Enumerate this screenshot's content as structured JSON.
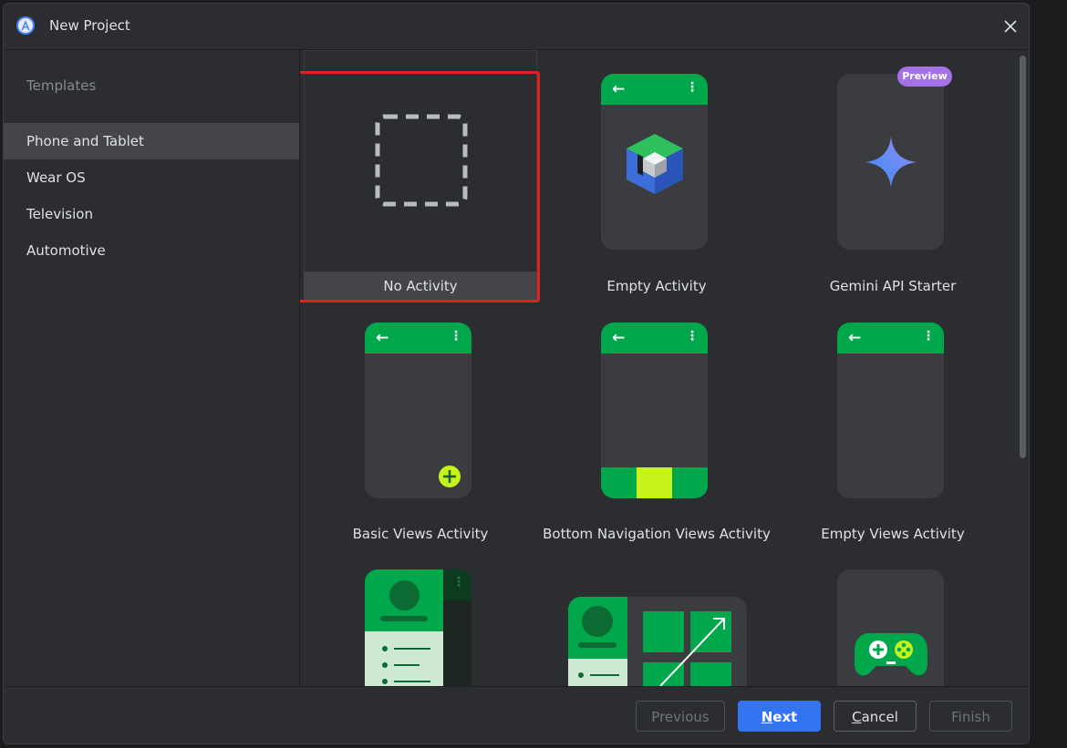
{
  "window": {
    "title": "New Project",
    "app_icon": "android-studio-icon",
    "close_icon": "close-icon"
  },
  "sidebar": {
    "header": "Templates",
    "items": [
      {
        "label": "Phone and Tablet",
        "selected": true
      },
      {
        "label": "Wear OS",
        "selected": false
      },
      {
        "label": "Television",
        "selected": false
      },
      {
        "label": "Automotive",
        "selected": false
      }
    ]
  },
  "templates": [
    {
      "label": "No Activity",
      "selected": true
    },
    {
      "label": "Empty Activity",
      "selected": false
    },
    {
      "label": "Gemini API Starter",
      "selected": false,
      "badge": "Preview"
    },
    {
      "label": "Basic Views Activity",
      "selected": false
    },
    {
      "label": "Bottom Navigation Views Activity",
      "selected": false
    },
    {
      "label": "Empty Views Activity",
      "selected": false
    },
    {
      "label": "",
      "selected": false
    },
    {
      "label": "",
      "selected": false
    },
    {
      "label": "",
      "selected": false
    }
  ],
  "footer": {
    "previous": "Previous",
    "next_prefix": "N",
    "next_rest": "ext",
    "cancel_prefix": "C",
    "cancel_rest": "ancel",
    "finish": "Finish"
  },
  "colors": {
    "accent": "#3574f0",
    "android_green": "#00a84b",
    "selection_outline": "#e32020",
    "preview_badge": "#a571e6"
  }
}
